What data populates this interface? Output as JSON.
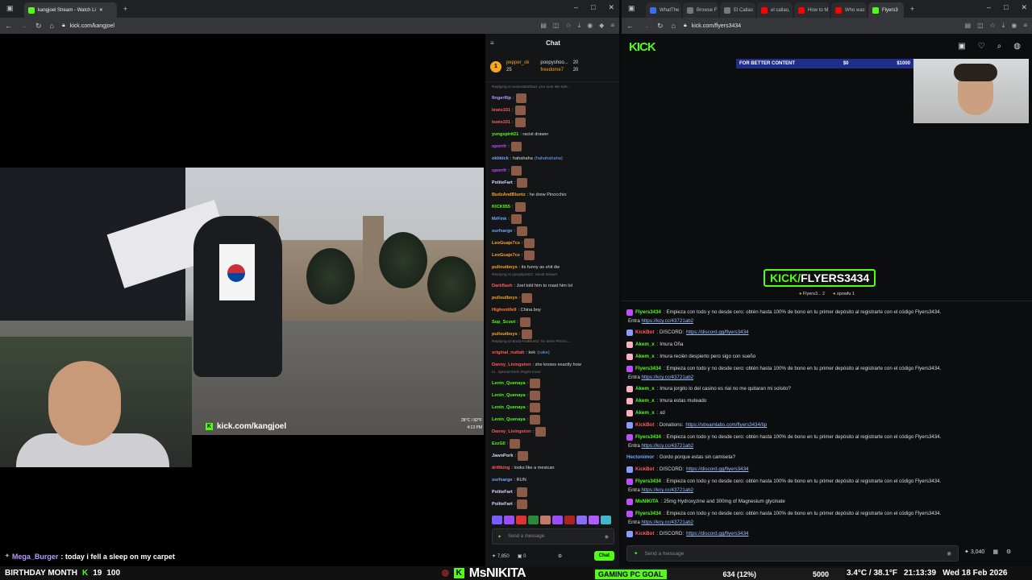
{
  "left_window": {
    "tabs": [
      {
        "label": "kangjoel Stream - Watch Li",
        "active": true
      }
    ],
    "url": "kick.com/kangjoel",
    "watermark": "kick.com/kangjoel",
    "video_overlay": {
      "temp": "28°C / 82°F",
      "time": "4:13 PM"
    },
    "overlay_message": {
      "user": "Mega_Burger",
      "text": ": today i fell a sleep on my carpet"
    }
  },
  "chat": {
    "title": "Chat",
    "pinned": {
      "rank": "1",
      "top_user": "pepper_ok",
      "top_amount": "25",
      "second_user": "poopyshoo...",
      "second_amount": "20",
      "third_user": "freedome7",
      "third_amount": "20"
    },
    "messages": [
      {
        "reply": "Replying to leannadotthad: you look like kek..."
      },
      {
        "user": "fingerflip",
        "color": "#b69aff",
        "text": "",
        "emote": true
      },
      {
        "user": "lewis101",
        "color": "#ff5a5a",
        "text": "",
        "emote": true
      },
      {
        "user": "lewis101",
        "color": "#ff5a5a",
        "text": "",
        "emote": true
      },
      {
        "user": "yungspirit21",
        "color": "#53fc18",
        "text": ": racist drawer"
      },
      {
        "user": "sporrfr",
        "color": "#c04cff",
        "text": "",
        "emote": true
      },
      {
        "user": "okbkick",
        "color": "#6fa8ff",
        "text": ": hahahaha",
        "extra": "(hahahahaha)"
      },
      {
        "user": "sporrfr",
        "color": "#c04cff",
        "text": "",
        "emote": true
      },
      {
        "user": "PoliteFart",
        "color": "#d8d8ff",
        "text": "",
        "emote": true
      },
      {
        "user": "BudzAndBluntz",
        "color": "#f5a623",
        "text": ": he drew Pinocchio"
      },
      {
        "user": "KICK955",
        "color": "#53fc18",
        "text": "",
        "emote": true
      },
      {
        "user": "MrFink",
        "color": "#6fa8ff",
        "text": "",
        "emote": true
      },
      {
        "user": "surfsarge",
        "color": "#6fa8ff",
        "text": "",
        "emote": true
      },
      {
        "user": "LeoGuaje7cx",
        "color": "#f5a623",
        "text": "",
        "emote": true
      },
      {
        "user": "LeoGuaje7cx",
        "color": "#f5a623",
        "text": "",
        "emote": true
      },
      {
        "user": "pulloutboys",
        "color": "#f5a623",
        "text": ": its funny as shit dw"
      },
      {
        "reply": "Replying to yungspirit21: racist drawer"
      },
      {
        "user": "Darkflash",
        "color": "#ff5a5a",
        "text": ": Joel told him to roast him lol"
      },
      {
        "user": "pulloutboys",
        "color": "#f5a623",
        "text": "",
        "emote": true
      },
      {
        "user": "Highonlife9",
        "color": "#ff7a3a",
        "text": ": China boy"
      },
      {
        "user": "Sup_Scoot",
        "color": "#53fc18",
        "text": "",
        "emote": true
      },
      {
        "user": "pulloutboys",
        "color": "#f5a623",
        "text": "",
        "emote": true
      },
      {
        "reply": "Replying to BudzAndBluntz: he drew Pinocc..."
      },
      {
        "user": "original_nuttah",
        "color": "#ff5a5a",
        "text": ": kek",
        "extra": "(cake)"
      },
      {
        "user": "Danny_Livingston",
        "color": "#ff5a5a",
        "text": ": she knows exactly how"
      },
      {
        "reply": "to.. spread them thighs lmao"
      },
      {
        "user": "Lenin_Quenaya",
        "color": "#53fc18",
        "text": "",
        "emote": true
      },
      {
        "user": "Lenin_Quenaya",
        "color": "#53fc18",
        "text": "",
        "emote": true
      },
      {
        "user": "Lenin_Quenaya",
        "color": "#53fc18",
        "text": "",
        "emote": true
      },
      {
        "user": "Lenin_Quenaya",
        "color": "#53fc18",
        "text": "",
        "emote": true
      },
      {
        "user": "Danny_Livingston",
        "color": "#ff5a5a",
        "text": "",
        "emote": true
      },
      {
        "user": "EzzG0",
        "color": "#53fc18",
        "text": "",
        "emote": true
      },
      {
        "user": "JawnPork",
        "color": "#d8d8ff",
        "text": "",
        "emote": true
      },
      {
        "user": "driftking",
        "color": "#ff5a5a",
        "text": ": looks like a mexican"
      },
      {
        "user": "surfsarge",
        "color": "#6fa8ff",
        "text": ": RUN"
      },
      {
        "user": "PoliteFart",
        "color": "#d8d8ff",
        "text": "",
        "emote": true
      },
      {
        "user": "PoliteFart",
        "color": "#d8d8ff",
        "text": "",
        "emote": true
      }
    ],
    "input_placeholder": "Send a message",
    "points": "7,850",
    "count": "0",
    "chat_button": "Chat"
  },
  "right_window": {
    "tabs": [
      {
        "label": "WhatThe",
        "icon": "bl"
      },
      {
        "label": "Browse F",
        "icon": "gr"
      },
      {
        "label": "El Callao",
        "icon": "gr"
      },
      {
        "label": "el callao,",
        "icon": "yt"
      },
      {
        "label": "How to M",
        "icon": "yt"
      },
      {
        "label": "Who was",
        "icon": "yt"
      },
      {
        "label": "Flyers3",
        "icon": "k",
        "active": true
      }
    ],
    "url": "kick.com/flyers3434",
    "logo": "KICK",
    "goal_banner": {
      "label": "FOR BETTER CONTENT",
      "current": "$0",
      "target": "$1000",
      "progress": 0
    },
    "tagline_prefix": "KICK/",
    "tagline_name": "FLYERS3434",
    "pinned": {
      "first": "Flyers3...",
      "first_amount": "2",
      "second": "zpowfu",
      "second_amount": "1"
    },
    "messages": [
      {
        "user": "Flyers3434",
        "color": "#53fc18",
        "badge": "p",
        "text": ": Empieza con todo y no desde cero: obtén hasta 100% de bono en tu primer depósito al registrarte con el código Flyers3434.",
        "line2": "Entra",
        "link": "https://kcy.cc/43721ab2"
      },
      {
        "user": "KickBot",
        "color": "#ff5a5a",
        "badge": "b",
        "text": ": DISCORD:",
        "link": "https://discord.gg/flyers3434"
      },
      {
        "user": "Akem_x",
        "color": "#53fc18",
        "badge": "pk",
        "text": ": Imura Oña"
      },
      {
        "user": "Akem_x",
        "color": "#53fc18",
        "badge": "pk",
        "text": ": Imura recién despierto pero sigo con sueño"
      },
      {
        "user": "Flyers3434",
        "color": "#53fc18",
        "badge": "p",
        "text": ": Empieza con todo y no desde cero: obtén hasta 100% de bono en tu primer depósito al registrarte con el código Flyers3434.",
        "line2": "Entra",
        "link": "https://kcy.cc/43721ab2"
      },
      {
        "user": "Akem_x",
        "color": "#53fc18",
        "badge": "pk",
        "text": ": Imura jorgito lo del casino es rial no me quitaran mi solsito?"
      },
      {
        "user": "Akem_x",
        "color": "#53fc18",
        "badge": "pk",
        "text": ": Imura estas muteado"
      },
      {
        "user": "Akem_x",
        "color": "#53fc18",
        "badge": "pk",
        "text": ": xd"
      },
      {
        "user": "KickBot",
        "color": "#ff5a5a",
        "badge": "b",
        "text": ": Donations:",
        "link": "https://streamlabs.com/flyers3434/tip"
      },
      {
        "user": "Flyers3434",
        "color": "#53fc18",
        "badge": "p",
        "text": ": Empieza con todo y no desde cero: obtén hasta 100% de bono en tu primer depósito al registrarte con el código Flyers3434.",
        "line2": "Entra",
        "link": "https://kcy.cc/43721ab2"
      },
      {
        "user": "Hectonimor",
        "color": "#6fa8ff",
        "badge": "",
        "text": ": Gordo porque estas sin camiseta?"
      },
      {
        "user": "KickBot",
        "color": "#ff5a5a",
        "badge": "b",
        "text": ": DISCORD:",
        "link": "https://discord.gg/flyers3434"
      },
      {
        "user": "Flyers3434",
        "color": "#53fc18",
        "badge": "p",
        "text": ": Empieza con todo y no desde cero: obtén hasta 100% de bono en tu primer depósito al registrarte con el código Flyers3434.",
        "line2": "Entra",
        "link": "https://kcy.cc/43721ab2"
      },
      {
        "user": "MsNIKITA",
        "color": "#53fc18",
        "badge": "p",
        "text": ": 25mg Hydroxyzine and 300mg of Magnesium glycinate"
      },
      {
        "user": "Flyers3434",
        "color": "#53fc18",
        "badge": "p",
        "text": ": Empieza con todo y no desde cero: obtén hasta 100% de bono en tu primer depósito al registrarte con el código Flyers3434.",
        "line2": "Entra",
        "link": "https://kcy.cc/43721ab2"
      },
      {
        "user": "KickBot",
        "color": "#ff5a5a",
        "badge": "b",
        "text": ": DISCORD:",
        "link": "https://discord.gg/flyers3434"
      }
    ],
    "input_placeholder": "Send a message",
    "points": "3,040"
  },
  "taskbar": {
    "left": "BIRTHDAY MONTH",
    "count1": "19",
    "count2": "100",
    "streamer": "MsNIKITA",
    "goal_label": "GAMING PC GOAL",
    "goal_value": "634 (12%)",
    "goal_progress": 0.12,
    "goal_target": "5000",
    "temp": "3.4°C / 38.1°F",
    "time": "21:13:39",
    "date": "Wed 18 Feb 2026"
  }
}
